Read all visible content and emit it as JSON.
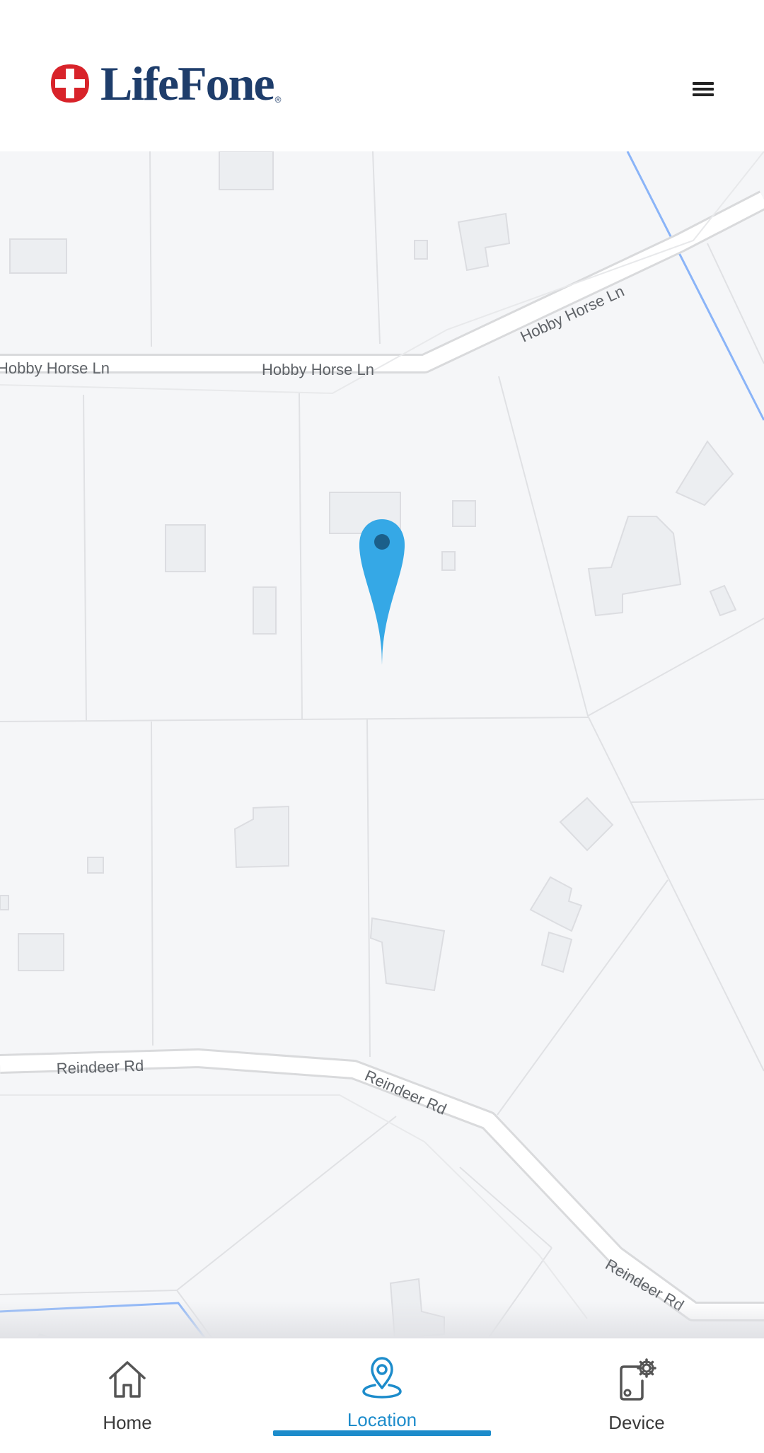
{
  "header": {
    "logo_text": "LifeFone",
    "logo_reg": "®",
    "menu_icon": "hamburger-menu-icon"
  },
  "map": {
    "roads": {
      "hobby_horse_1": "Hobby Horse Ln",
      "hobby_horse_2": "Hobby Horse Ln",
      "hobby_horse_3": "Hobby Horse Ln",
      "reindeer_1": "Reindeer Rd",
      "reindeer_2": "Reindeer Rd",
      "reindeer_3": "Reindeer Rd"
    },
    "marker_icon": "location-pin-icon",
    "colors": {
      "background": "#f5f6f8",
      "parcel_line": "#e0e1e4",
      "building_fill": "#eceef1",
      "road_fill": "#ffffff",
      "road_edge": "#d9dadc",
      "water_line": "#8ab4f8",
      "marker": "#35a8e6",
      "marker_dot": "#1b5f8a"
    }
  },
  "tabs": [
    {
      "label": "Home",
      "icon": "home-icon",
      "active": false
    },
    {
      "label": "Location",
      "icon": "location-icon",
      "active": true
    },
    {
      "label": "Device",
      "icon": "device-settings-icon",
      "active": false
    }
  ],
  "colors": {
    "brand_navy": "#1e3d6b",
    "brand_red": "#d8232a",
    "accent": "#1d8ccb"
  }
}
